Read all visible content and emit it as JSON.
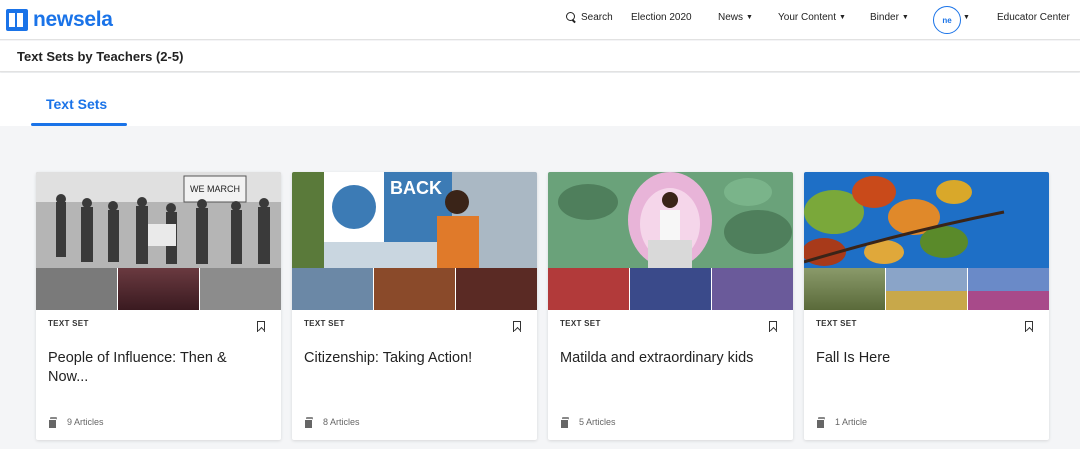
{
  "nav": {
    "logo_text": "newsela",
    "items": [
      {
        "label": "Search",
        "name": "nav-search"
      },
      {
        "label": "Election 2020",
        "name": "nav-election-2020"
      },
      {
        "label": "News",
        "name": "nav-news"
      },
      {
        "label": "Your Content",
        "name": "nav-your-content"
      },
      {
        "label": "Binder",
        "name": "nav-binder"
      },
      {
        "label": "Educator Center",
        "name": "nav-educator-center"
      }
    ],
    "avatar_initials": "ne"
  },
  "page": {
    "title": "Text Sets by Teachers (2-5)",
    "tabs": [
      {
        "label": "Text Sets",
        "active": true
      }
    ]
  },
  "cards": [
    {
      "type": "TEXT SET",
      "title": "People of Influence: Then & Now...",
      "count": "9 Articles",
      "hero_colors": [
        "#9a9a9a",
        "#5c5c5c",
        "#c8c8c8"
      ],
      "thumb_colors": [
        "#7a7a7a",
        "#6a3a40",
        "#8c8c8c"
      ]
    },
    {
      "type": "TEXT SET",
      "title": "Citizenship: Taking Action!",
      "count": "8 Articles",
      "hero_colors": [
        "#3c7bb5",
        "#e07a2a",
        "#c9d6e0"
      ],
      "thumb_colors": [
        "#6b88a6",
        "#8a4a2a",
        "#5a2a24"
      ]
    },
    {
      "type": "TEXT SET",
      "title": "Matilda and extraordinary kids",
      "count": "5 Articles",
      "hero_colors": [
        "#6aa27a",
        "#e8b4d8",
        "#4f7f5c"
      ],
      "thumb_colors": [
        "#b23a3a",
        "#3a4a8a",
        "#6a5a9a"
      ]
    },
    {
      "type": "TEXT SET",
      "title": "Fall Is Here",
      "count": "1 Article",
      "hero_colors": [
        "#1e6fc6",
        "#e0892a",
        "#7aa83a"
      ],
      "thumb_colors": [
        "#6a7a4a",
        "#8aa4c8",
        "#a84a8a"
      ]
    }
  ],
  "colors": {
    "accent": "#1a73e8"
  }
}
